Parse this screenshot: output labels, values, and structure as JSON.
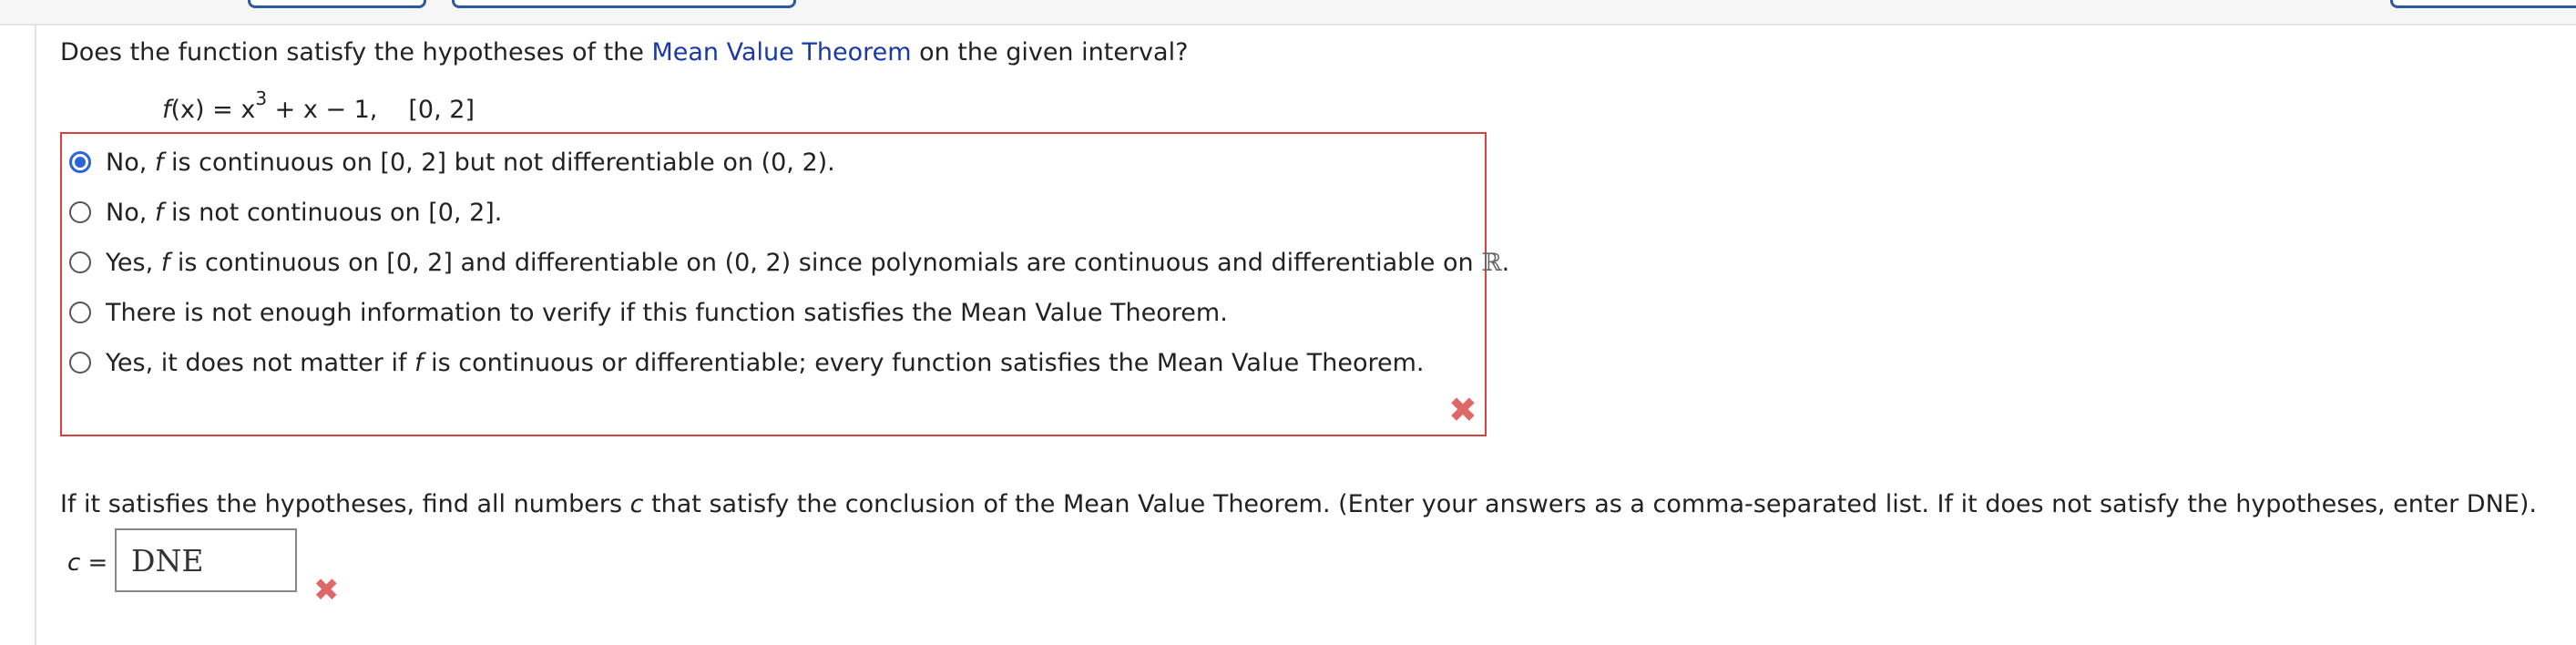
{
  "question": {
    "prefix": "Does the function satisfy the hypotheses of the ",
    "link_text": "Mean Value Theorem",
    "suffix": " on the given interval?"
  },
  "formula": {
    "f": "f",
    "lhs_rest": "(x) = x",
    "exponent": "3",
    "rhs_rest": " + x − 1,",
    "interval": "[0, 2]"
  },
  "choices": [
    {
      "selected": true,
      "before": "No, ",
      "italic": "f",
      "after": " is continuous on [0, 2] but not differentiable on (0, 2)."
    },
    {
      "selected": false,
      "before": "No, ",
      "italic": "f",
      "after": " is not continuous on [0, 2]."
    },
    {
      "selected": false,
      "before": "Yes, ",
      "italic": "f",
      "after": " is continuous on [0, 2] and differentiable on (0, 2) since polynomials are continuous and differentiable on ",
      "reals": "ℝ",
      "end": "."
    },
    {
      "selected": false,
      "before": "There is not enough information to verify if this function satisfies the Mean Value Theorem."
    },
    {
      "selected": false,
      "before": "Yes, it does not matter if ",
      "italic": "f",
      "after": " is continuous or differentiable; every function satisfies the Mean Value Theorem."
    }
  ],
  "feedback": {
    "incorrect_icon": "x-mark-icon",
    "color": "#e06767"
  },
  "part_b": {
    "before": "If it satisfies the hypotheses, find all numbers ",
    "italic": "c",
    "after": " that satisfy the conclusion of the Mean Value Theorem. (Enter your answers as a comma-separated list. If it does not satisfy the hypotheses, enter DNE)."
  },
  "answer": {
    "var": "c",
    "equals": " =",
    "value": "DNE"
  },
  "colors": {
    "link": "#1a39a8",
    "error_border": "#d94040",
    "radio_selected": "#2b63d9",
    "top_button_border": "#2b5c9a"
  }
}
